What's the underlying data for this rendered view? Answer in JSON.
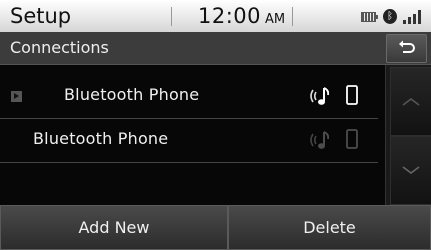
{
  "status_bar": {
    "title": "Setup",
    "time": "12:00",
    "ampm": "AM",
    "icons": [
      "battery-icon",
      "bluetooth-icon",
      "signal-icon"
    ]
  },
  "header": {
    "title": "Connections",
    "back_icon": "back-arrow-icon"
  },
  "devices": [
    {
      "name": "Bluetooth Phone",
      "selected": true,
      "connected": true
    },
    {
      "name": "Bluetooth Phone",
      "selected": false,
      "connected": false
    }
  ],
  "scroll": {
    "up_icon": "chevron-up-icon",
    "down_icon": "chevron-down-icon"
  },
  "buttons": {
    "add_new": "Add New",
    "delete": "Delete"
  }
}
